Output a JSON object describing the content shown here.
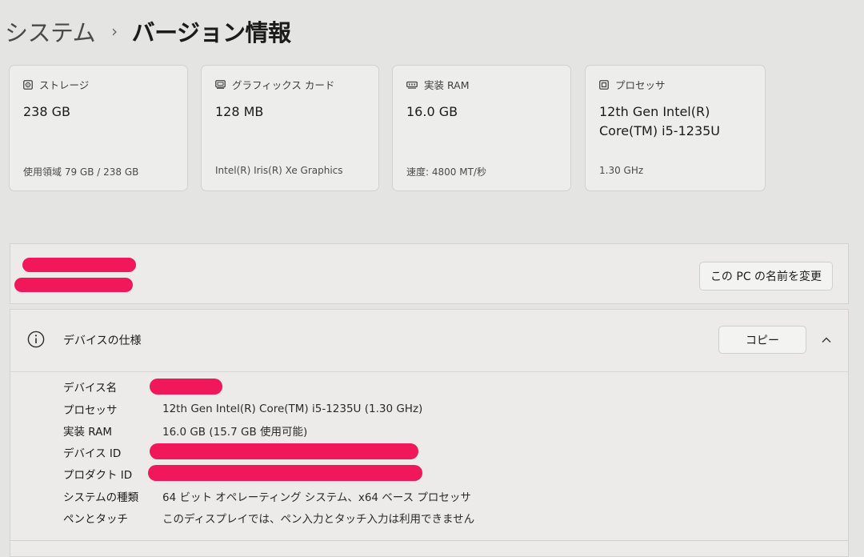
{
  "breadcrumb": {
    "parent": "システム",
    "separator": "›",
    "current": "バージョン情報"
  },
  "cards": [
    {
      "icon": "storage-icon",
      "label": "ストレージ",
      "value": "238 GB",
      "sub": "使用領域 79 GB / 238 GB"
    },
    {
      "icon": "graphics-card-icon",
      "label": "グラフィックス カード",
      "value": "128 MB",
      "sub": "Intel(R) Iris(R) Xe Graphics"
    },
    {
      "icon": "ram-icon",
      "label": "実装 RAM",
      "value": "16.0 GB",
      "sub": "速度: 4800 MT/秒"
    },
    {
      "icon": "processor-icon",
      "label": "プロセッサ",
      "value": "12th Gen Intel(R) Core(TM) i5-1235U",
      "sub": "1.30 GHz"
    }
  ],
  "rename": {
    "button_label": "この PC の名前を変更"
  },
  "device_specs": {
    "title": "デバイスの仕様",
    "copy_label": "コピー",
    "rows": [
      {
        "key": "デバイス名",
        "value": ""
      },
      {
        "key": "プロセッサ",
        "value": "12th Gen Intel(R) Core(TM) i5-1235U (1.30 GHz)"
      },
      {
        "key": "実装 RAM",
        "value": "16.0 GB (15.7 GB 使用可能)"
      },
      {
        "key": "デバイス ID",
        "value": ""
      },
      {
        "key": "プロダクト ID",
        "value": ""
      },
      {
        "key": "システムの種類",
        "value": "64 ビット オペレーティング システム、x64 ベース プロセッサ"
      },
      {
        "key": "ペンとタッチ",
        "value": "このディスプレイでは、ペン入力とタッチ入力は利用できません"
      }
    ]
  },
  "colors": {
    "background": "#e4e4e2",
    "card": "#ededeb",
    "redaction": "#f0185a"
  }
}
